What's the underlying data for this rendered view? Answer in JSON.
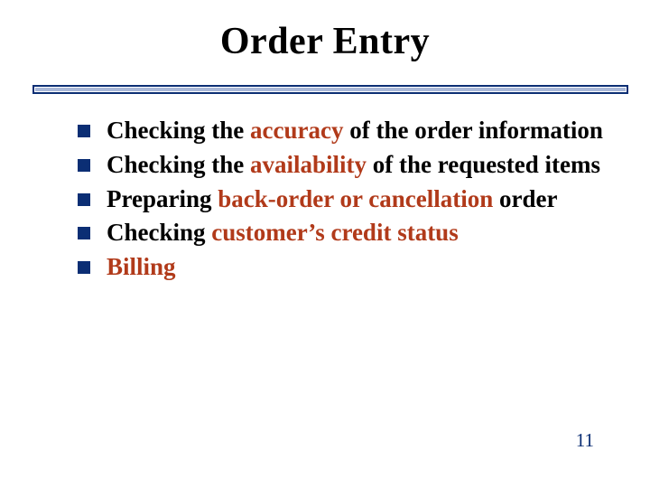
{
  "title": "Order Entry",
  "bullets": {
    "b0": {
      "pre": "Checking the ",
      "em": "accuracy",
      "post": " of the order information"
    },
    "b1": {
      "pre": "Checking the ",
      "em": "availability",
      "post": " of the requested items"
    },
    "b2": {
      "pre": "Preparing ",
      "em": "back-order or cancellation ",
      "post": " order"
    },
    "b3": {
      "pre": "Checking ",
      "em": "customer’s credit status",
      "post": ""
    },
    "b4": {
      "pre": "",
      "em": "Billing",
      "post": ""
    }
  },
  "page_number": "11"
}
